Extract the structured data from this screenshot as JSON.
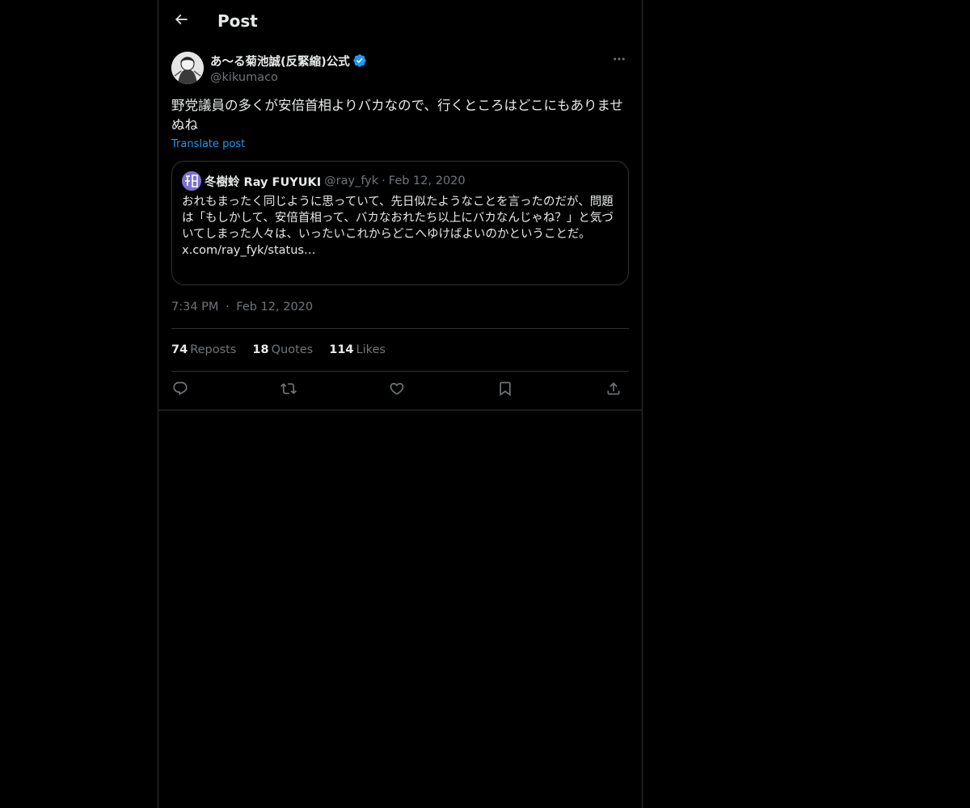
{
  "header": {
    "title": "Post",
    "back_icon": "arrow-left-icon"
  },
  "post": {
    "author": {
      "display_name": "あ〜る菊池誠(反緊縮)公式",
      "handle": "@kikumaco",
      "verified": true,
      "verified_color": "#1d9bf0"
    },
    "text": "野党議員の多くが安倍首相よりバカなので、行くところはどこにもありませぬね",
    "translate_label": "Translate post",
    "quote": {
      "display_name": "冬樹蛉 Ray FUYUKI",
      "handle": "@ray_fyk",
      "separator": "·",
      "date": "Feb 12, 2020",
      "text": "おれもまったく同じように思っていて、先日似たようなことを言ったのだが、問題は「もしかして、安倍首相って、バカなおれたち以上にバカなんじゃね？」と気づいてしまった人々は、いったいこれからどこへゆけばよいのかということだ。",
      "link": "x.com/ray_fyk/status…"
    },
    "timestamp": {
      "time": "7:34 PM",
      "separator": "·",
      "date": "Feb 12, 2020"
    },
    "stats": {
      "reposts_count": "74",
      "reposts_label": "Reposts",
      "quotes_count": "18",
      "quotes_label": "Quotes",
      "likes_count": "114",
      "likes_label": "Likes"
    },
    "actions": [
      "reply-icon",
      "repost-icon",
      "like-icon",
      "bookmark-icon",
      "share-icon"
    ]
  },
  "colors": {
    "background": "#000000",
    "text_primary": "#e7e9ea",
    "text_secondary": "#71767b",
    "border": "#2f3336",
    "accent": "#1d9bf0"
  }
}
